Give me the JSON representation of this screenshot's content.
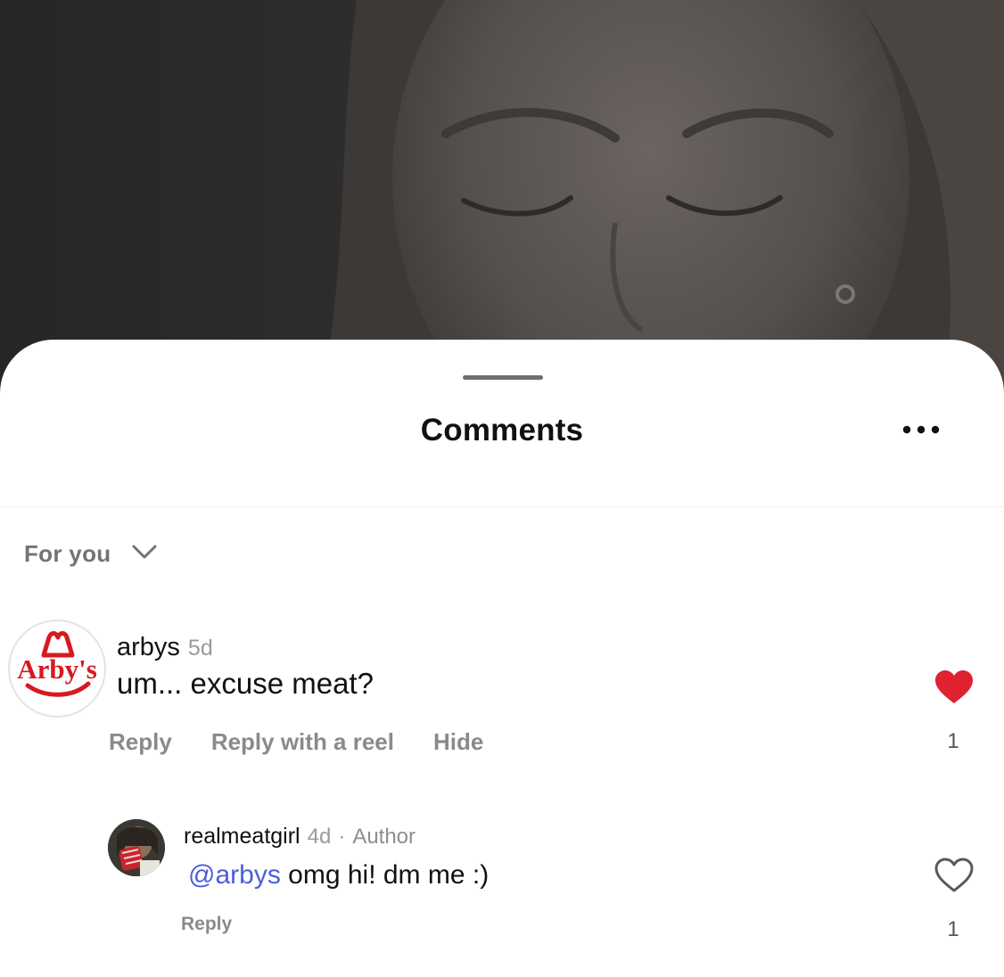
{
  "sheet": {
    "title": "Comments",
    "more_icon": "more-horizontal-icon",
    "sort_label": "For you",
    "sort_icon": "chevron-down-icon"
  },
  "comments": [
    {
      "username": "arbys",
      "time": "5d",
      "avatar_text": "Arby's",
      "text": "um... excuse meat?",
      "actions": [
        "Reply",
        "Reply with a reel",
        "Hide"
      ],
      "liked": true,
      "like_icon": "heart-filled-icon",
      "like_count": "1"
    }
  ],
  "reply": {
    "username": "realmeatgirl",
    "time": "4d",
    "separator": "·",
    "badge": "Author",
    "mention": "@arbys",
    "text": " omg hi! dm me :)",
    "actions": [
      "Reply"
    ],
    "liked": false,
    "like_icon": "heart-outline-icon",
    "like_count": "1"
  },
  "colors": {
    "like_red": "#e0212f",
    "mention_blue": "#4a5fd9",
    "arbys_red": "#d71920"
  }
}
